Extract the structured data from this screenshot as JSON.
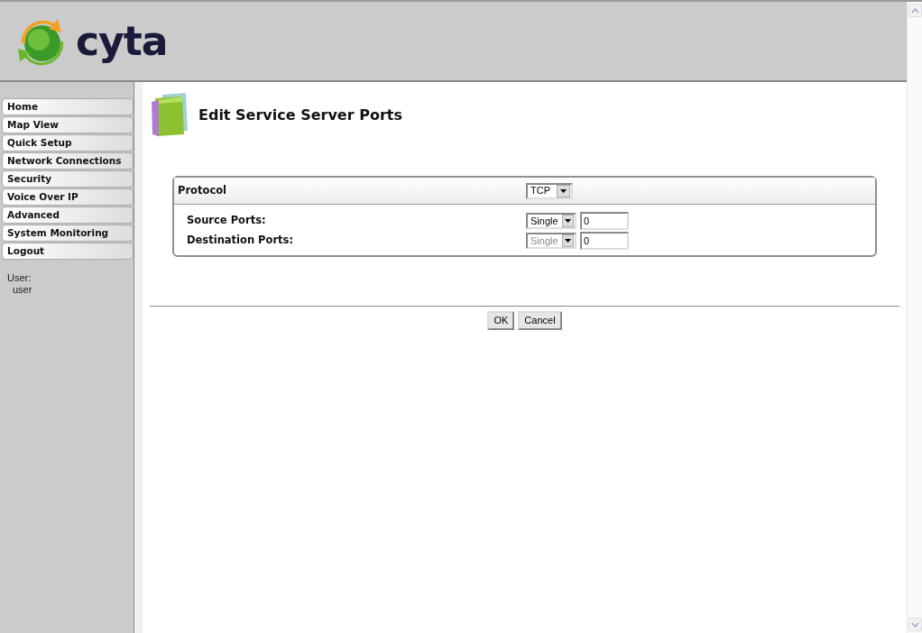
{
  "logo": {
    "text": "cyta"
  },
  "menu": [
    {
      "label": "Home"
    },
    {
      "label": "Map View"
    },
    {
      "label": "Quick Setup"
    },
    {
      "label": "Network Connections"
    },
    {
      "label": "Security"
    },
    {
      "label": "Voice Over IP"
    },
    {
      "label": "Advanced"
    },
    {
      "label": "System Monitoring"
    },
    {
      "label": "Logout"
    }
  ],
  "user": {
    "label": "User:",
    "name": "user"
  },
  "page_title": "Edit Service Server Ports",
  "form": {
    "protocol": {
      "label": "Protocol",
      "value": "TCP"
    },
    "ports": [
      {
        "label": "Source Ports:",
        "mode": "Single",
        "value": "0",
        "disabled": false
      },
      {
        "label": "Destination Ports:",
        "mode": "Single",
        "value": "0",
        "disabled": true
      }
    ]
  },
  "buttons": [
    "OK",
    "Cancel"
  ]
}
